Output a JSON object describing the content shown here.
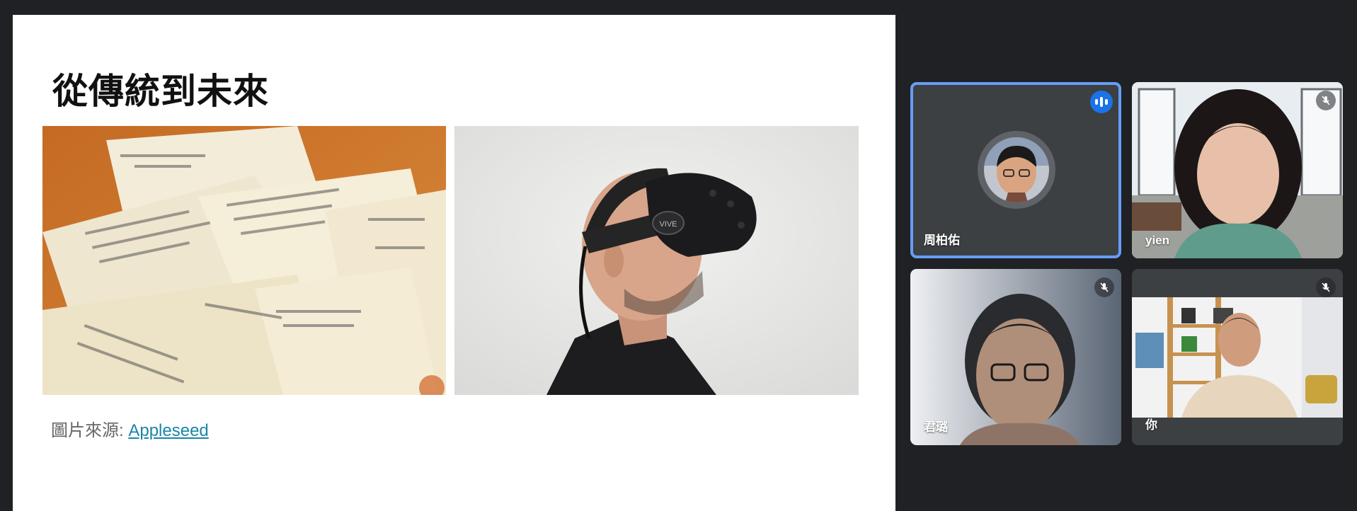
{
  "slide": {
    "title": "從傳統到未來",
    "caption_label": "圖片來源: ",
    "caption_link": "Appleseed",
    "photos": [
      {
        "name": "receipts-photo"
      },
      {
        "name": "vr-headset-photo",
        "headset_brand": "VIVE"
      }
    ]
  },
  "participants": [
    {
      "name": "周柏佑",
      "state": "speaking",
      "view": "avatar",
      "highlight": "#669df6"
    },
    {
      "name": "yien",
      "state": "muted",
      "view": "video"
    },
    {
      "name": "君璐",
      "state": "muted",
      "view": "video"
    },
    {
      "name": "你",
      "state": "muted",
      "view": "video"
    }
  ],
  "icons": {
    "speaking": "audio-bars-icon",
    "muted": "mic-off-icon"
  },
  "colors": {
    "background": "#202124",
    "speaking_accent": "#1a73e8",
    "link": "#1a86a8"
  }
}
